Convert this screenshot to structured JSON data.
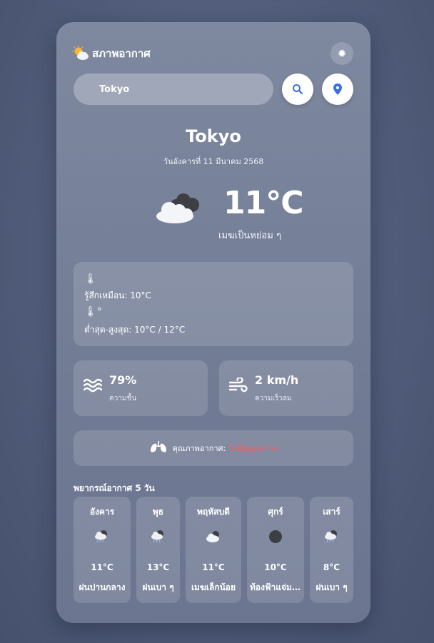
{
  "header": {
    "title": "สภาพอากาศ"
  },
  "search": {
    "value": "Tokyo"
  },
  "current": {
    "city": "Tokyo",
    "date": "วันอังคารที่ 11 มีนาคม 2568",
    "temperature": "11°C",
    "description": "เมฆเป็นหย่อม ๆ"
  },
  "details": {
    "feels_like": "รู้สึกเหมือน: 10°C",
    "min_max": "ต่ำสุด-สูงสุด: 10°C / 12°C"
  },
  "stats": {
    "humidity_value": "79%",
    "humidity_label": "ความชื้น",
    "wind_value": "2 km/h",
    "wind_label": "ความเร็วลม"
  },
  "air_quality": {
    "label": "คุณภาพอากาศ:",
    "value": "ไม่ดีต่อสุขภาพ",
    "value_color": "#ff5c5c"
  },
  "forecast": {
    "title": "พยากรณ์อากาศ 5 วัน",
    "days": [
      {
        "day": "อังคาร",
        "temp": "11°C",
        "desc": "ฝนปานกลาง",
        "icon": "rain-cloud-icon"
      },
      {
        "day": "พุธ",
        "temp": "13°C",
        "desc": "ฝนเบา ๆ",
        "icon": "rain-cloud-icon"
      },
      {
        "day": "พฤหัสบดี",
        "temp": "11°C",
        "desc": "เมฆเล็กน้อย",
        "icon": "cloud-icon"
      },
      {
        "day": "ศุกร์",
        "temp": "10°C",
        "desc": "ท้องฟ้าแจ่มใส",
        "icon": "dark-circle-icon"
      },
      {
        "day": "เสาร์",
        "temp": "8°C",
        "desc": "ฝนเบา ๆ",
        "icon": "rain-cloud-icon"
      }
    ]
  },
  "colors": {
    "accent": "#3b6fe0",
    "card": "#7a849c"
  }
}
